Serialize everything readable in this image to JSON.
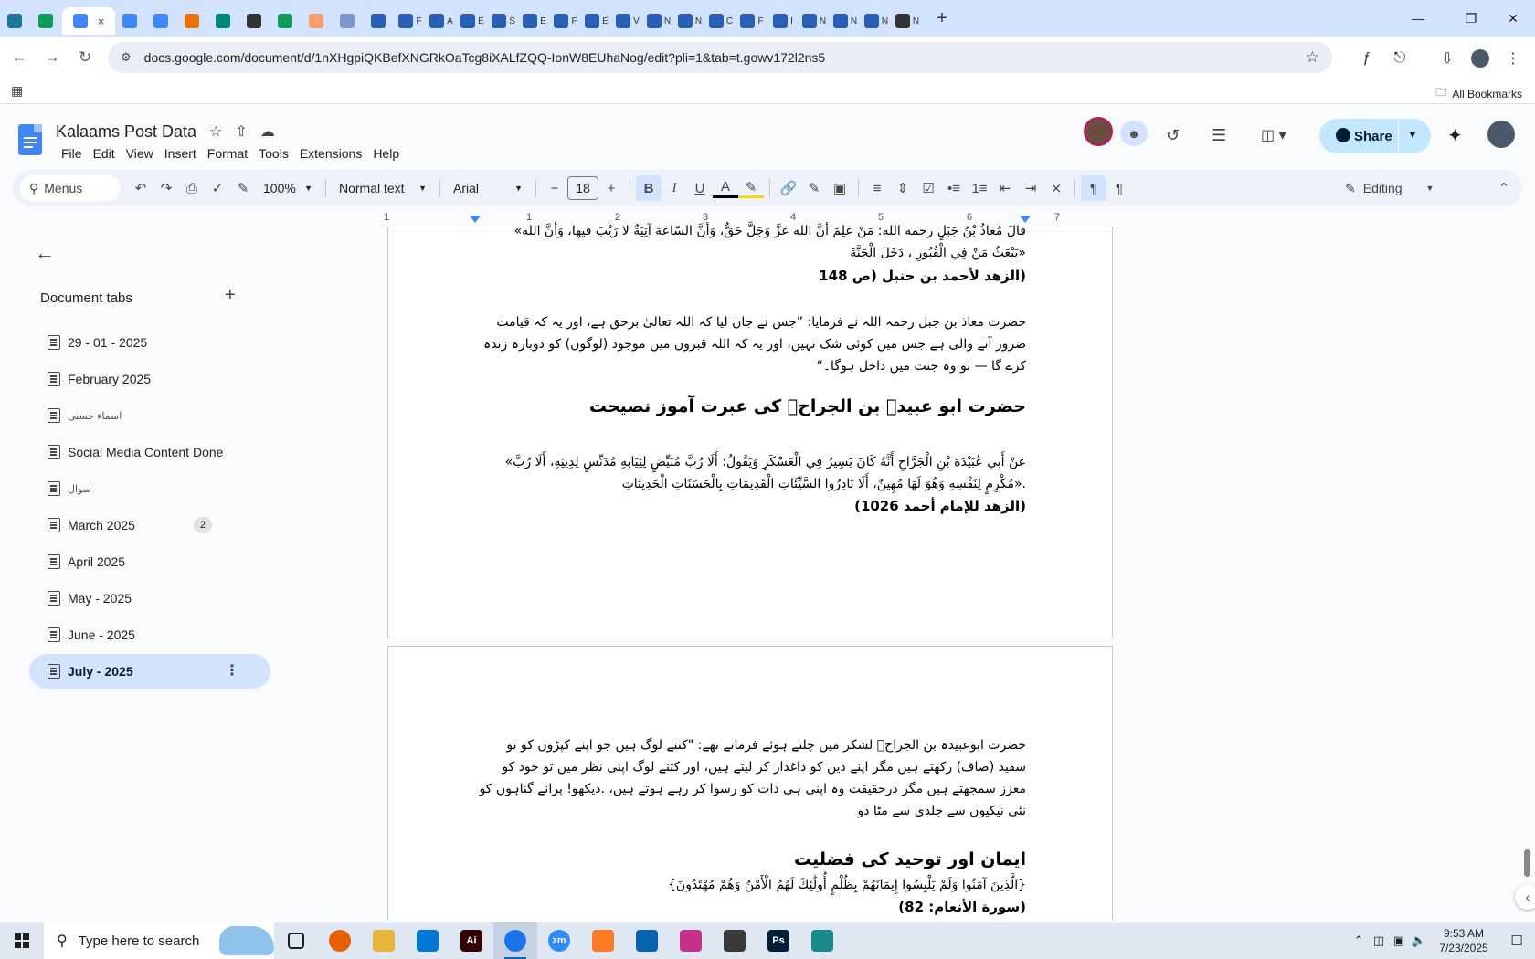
{
  "browser": {
    "tabs": [
      {
        "icon": "wordpress-icon",
        "color": "#21759b",
        "label": ""
      },
      {
        "icon": "sheets-icon",
        "color": "#0f9d58",
        "label": ""
      },
      {
        "icon": "docs-icon",
        "color": "#4285f4",
        "label": "",
        "active": true
      },
      {
        "icon": "docs-icon",
        "color": "#4285f4",
        "label": ""
      },
      {
        "icon": "docs-icon",
        "color": "#4285f4",
        "label": ""
      },
      {
        "icon": "extension-icon",
        "color": "#e8710a",
        "label": ""
      },
      {
        "icon": "app-icon",
        "color": "#00897b",
        "label": ""
      },
      {
        "icon": "openai-icon",
        "color": "#333333",
        "label": ""
      },
      {
        "icon": "sheets-icon",
        "color": "#0f9d58",
        "label": ""
      },
      {
        "icon": "hand-icon",
        "color": "#f5a06b",
        "label": ""
      },
      {
        "icon": "grid-icon",
        "color": "#7b97c9",
        "label": ""
      },
      {
        "icon": "forms-icon",
        "color": "#2b5fb4",
        "label": ""
      },
      {
        "icon": "forms-icon",
        "color": "#2b5fb4",
        "label": "F"
      },
      {
        "icon": "forms-icon",
        "color": "#2b5fb4",
        "label": "A"
      },
      {
        "icon": "forms-icon",
        "color": "#2b5fb4",
        "label": "E"
      },
      {
        "icon": "forms-icon",
        "color": "#2b5fb4",
        "label": "S"
      },
      {
        "icon": "forms-icon",
        "color": "#2b5fb4",
        "label": "E"
      },
      {
        "icon": "forms-icon",
        "color": "#2b5fb4",
        "label": "F"
      },
      {
        "icon": "forms-icon",
        "color": "#2b5fb4",
        "label": "E"
      },
      {
        "icon": "forms-icon",
        "color": "#2b5fb4",
        "label": "V"
      },
      {
        "icon": "forms-icon",
        "color": "#2b5fb4",
        "label": "N"
      },
      {
        "icon": "forms-icon",
        "color": "#2b5fb4",
        "label": "N"
      },
      {
        "icon": "forms-icon",
        "color": "#2b5fb4",
        "label": "C"
      },
      {
        "icon": "forms-icon",
        "color": "#2b5fb4",
        "label": "F"
      },
      {
        "icon": "forms-icon",
        "color": "#2b5fb4",
        "label": "I"
      },
      {
        "icon": "forms-icon",
        "color": "#2b5fb4",
        "label": "N"
      },
      {
        "icon": "forms-icon",
        "color": "#2b5fb4",
        "label": "N"
      },
      {
        "icon": "forms-icon",
        "color": "#2b5fb4",
        "label": "N"
      },
      {
        "icon": "openai-icon",
        "color": "#333333",
        "label": "N"
      }
    ],
    "url": "docs.google.com/document/d/1nXHgpiQKBefXNGRkOaTcg8iXALfZQQ-IonW8EUhaNog/edit?pli=1&tab=t.gowv172l2ns5",
    "all_bookmarks": "All Bookmarks"
  },
  "doc": {
    "title": "Kalaams Post Data",
    "menu": [
      "File",
      "Edit",
      "View",
      "Insert",
      "Format",
      "Tools",
      "Extensions",
      "Help"
    ],
    "share": "Share"
  },
  "toolbar": {
    "menus": "Menus",
    "zoom": "100%",
    "style": "Normal text",
    "font": "Arial",
    "size": "18",
    "mode": "Editing"
  },
  "ruler": [
    "1",
    "1",
    "2",
    "3",
    "4",
    "5",
    "6",
    "7"
  ],
  "sidebar": {
    "heading": "Document tabs",
    "tabs": [
      {
        "label": "29 - 01 - 2025"
      },
      {
        "label": "February 2025"
      },
      {
        "label": "اسماء حسنی",
        "small": true
      },
      {
        "label": "Social Media Content Done"
      },
      {
        "label": "سوال",
        "small": true
      },
      {
        "label": "March 2025",
        "badge": "2"
      },
      {
        "label": "April 2025"
      },
      {
        "label": "May - 2025"
      },
      {
        "label": "June - 2025"
      },
      {
        "label": "July - 2025",
        "active": true
      }
    ]
  },
  "page1": {
    "arabic_cut": "قالَ مُعاذُ بْنُ جَبَلٍ رحمه الله: مَنْ عَلِمَ أنَّ الله عَزَّ وَجَلَّ حَقٌّ، وَأنَّ السّاعَةَ آتِيَةٌ لا رَيْبَ فيها، وَأنَّ الله»",
    "arabic_cut2": "«يَبْعَثُ مَنْ فِي الْقُبُورِ ، دَخَلَ الْجَنَّةَ",
    "ref1": "(الزهد لأحمد بن حنبل (ص 148",
    "urdu1": "حضرت معاذ بن جبل رحمہ اللہ نے فرمایا: ”جس نے جان لیا کہ اللہ تعالیٰ برحق ہے، اور یہ کہ قیامت ضرور آنے والی ہے جس میں کوئی شک نہیں، اور یہ کہ اللہ قبروں میں موجود (لوگوں) کو دوبارہ زندہ کرے گا — تو وہ جنت میں داخل ہوگا۔“",
    "heading": "حضرت ابو عبیدہ بن الجراحؓ کی عبرت آموز نصیحت",
    "arabic2": "عَنْ أَبِي عُبَيْدَةَ بْنِ الْجَرَّاحِ أَنَّهُ كَانَ يَسِيرُ فِي الْعَسْكَرِ وَيَقُولُ: أَلَا رُبَّ مُبَيِّضٍ لِثِيَابِهِ مُدَنِّسٍ لِدِينِهِ، أَلَا رُبَّ» .«مُكْرِمٍ لِنَفْسِهِ وَهُوَ لَهَا مُهِينٌ، أَلَا بَادِرُوا السَّيِّئَاتِ الْقَدِيمَاتِ بِالْحَسَنَاتِ الْحَدِيثَاتِ",
    "ref2": "(الزهد للإمام أحمد 1026)"
  },
  "page2": {
    "urdu2": "حضرت ابوعبیدہ بن الجراحؓ لشکر میں چلتے ہوئے فرماتے تھے: \"کتنے لوگ ہیں جو اپنے کپڑوں کو تو سفید (صاف) رکھتے ہیں مگر اپنے دین کو داغدار کر لیتے ہیں، اور کتنے لوگ اپنی نظر میں تو خود کو معزز سمجھتے ہیں مگر درحقیقت وہ اپنی ہی ذات کو رسوا کر رہے ہوتے ہیں، .دیکھو! پرانے گناہوں کو نئی نیکیوں سے جلدی سے مٹا دو",
    "heading2": "ایمان اور توحید کی فضلیت",
    "verse": "{الَّذِينَ آمَنُوا وَلَمْ يَلْبِسُوا إِيمَانَهُمْ بِظُلْمٍ أُولَٰئِكَ لَهُمُ الْأَمْنُ وَهُمْ مُهْتَدُونَ}",
    "ref3": "(سورة الأنعام: 82)"
  },
  "taskbar": {
    "search": "Type here to search",
    "apps": [
      {
        "icon": "task-view-icon",
        "color": "#dfe7f3",
        "label": ""
      },
      {
        "icon": "firefox-icon",
        "color": "#e66000",
        "label": ""
      },
      {
        "icon": "file-explorer-icon",
        "color": "#e8b339",
        "label": ""
      },
      {
        "icon": "vscode-icon",
        "color": "#0078d4",
        "label": ""
      },
      {
        "icon": "illustrator-icon",
        "color": "#330000",
        "label": "Ai"
      },
      {
        "icon": "chrome-icon",
        "color": "#1a73e8",
        "label": "",
        "active": true
      },
      {
        "icon": "zoom-icon",
        "color": "#2d8cff",
        "label": "zm"
      },
      {
        "icon": "xampp-icon",
        "color": "#fb7a24",
        "label": ""
      },
      {
        "icon": "outlook-icon",
        "color": "#0a64ad",
        "label": ""
      },
      {
        "icon": "photos-icon",
        "color": "#c4308a",
        "label": ""
      },
      {
        "icon": "pen-icon",
        "color": "#3a3a3a",
        "label": ""
      },
      {
        "icon": "photoshop-icon",
        "color": "#001e36",
        "label": "Ps"
      },
      {
        "icon": "app-icon",
        "color": "#1b8a8a",
        "label": ""
      }
    ],
    "time": "9:53 AM",
    "date": "7/23/2025"
  }
}
